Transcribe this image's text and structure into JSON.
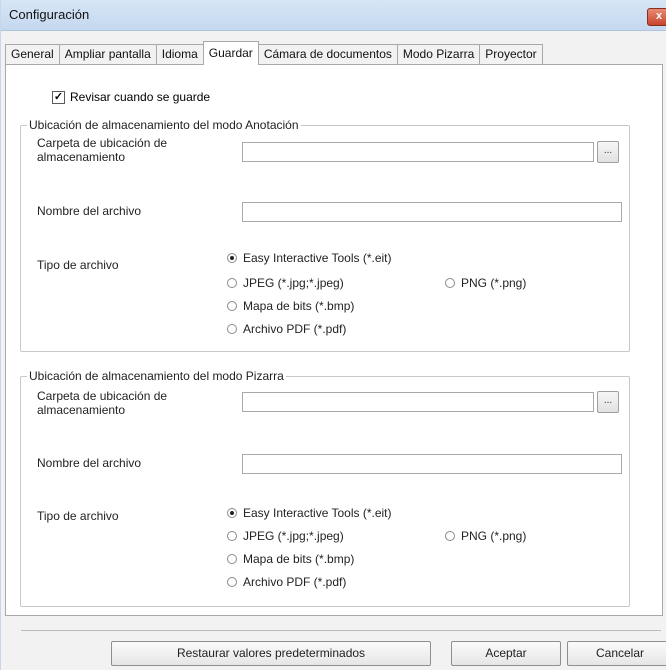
{
  "window": {
    "title": "Configuración",
    "close_label": "x"
  },
  "tabs": [
    {
      "label": "General"
    },
    {
      "label": "Ampliar pantalla"
    },
    {
      "label": "Idioma"
    },
    {
      "label": "Guardar"
    },
    {
      "label": "Cámara de documentos"
    },
    {
      "label": "Modo Pizarra"
    },
    {
      "label": "Proyector"
    }
  ],
  "active_tab": "Guardar",
  "review_checkbox": {
    "label": "Revisar cuando se guarde",
    "checked": true
  },
  "annotation_group": {
    "legend": "Ubicación de almacenamiento del modo Anotación",
    "folder_label": "Carpeta de ubicación de almacenamiento",
    "folder_value": "",
    "browse_label": "...",
    "filename_label": "Nombre del archivo",
    "filename_value": "",
    "filetype_label": "Tipo de archivo",
    "options": [
      {
        "label": "Easy Interactive Tools (*.eit)",
        "selected": true
      },
      {
        "label": "JPEG (*.jpg;*.jpeg)",
        "selected": false
      },
      {
        "label": "PNG (*.png)",
        "selected": false
      },
      {
        "label": "Mapa de bits (*.bmp)",
        "selected": false
      },
      {
        "label": "Archivo PDF (*.pdf)",
        "selected": false
      }
    ]
  },
  "whiteboard_group": {
    "legend": "Ubicación de almacenamiento del modo Pizarra",
    "folder_label": "Carpeta de ubicación de almacenamiento",
    "folder_value": "",
    "browse_label": "...",
    "filename_label": "Nombre del archivo",
    "filename_value": "",
    "filetype_label": "Tipo de archivo",
    "options": [
      {
        "label": "Easy Interactive Tools (*.eit)",
        "selected": true
      },
      {
        "label": "JPEG (*.jpg;*.jpeg)",
        "selected": false
      },
      {
        "label": "PNG (*.png)",
        "selected": false
      },
      {
        "label": "Mapa de bits (*.bmp)",
        "selected": false
      },
      {
        "label": "Archivo PDF (*.pdf)",
        "selected": false
      }
    ]
  },
  "buttons": {
    "restore": "Restaurar valores predeterminados",
    "ok": "Aceptar",
    "cancel": "Cancelar"
  }
}
